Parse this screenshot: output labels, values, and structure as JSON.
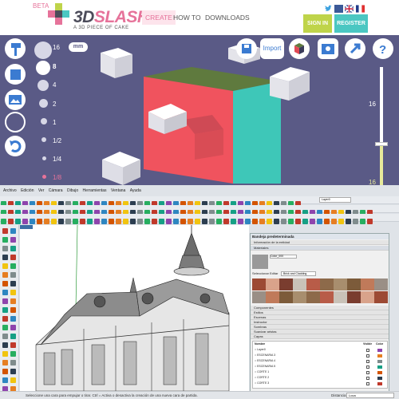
{
  "topbar": {
    "beta": "BETA",
    "logo_main": "3D",
    "logo_accent": "SLASH",
    "logo_tagline": "A 3D PIECE OF CAKE",
    "nav": {
      "create": "CREATE",
      "howto": "HOW TO",
      "downloads": "DOWNLOADS"
    },
    "signin": "SIGN IN",
    "register": "REGISTER",
    "social_icons": [
      "twitter-icon",
      "facebook-icon",
      "uk-flag-icon",
      "france-flag-icon"
    ]
  },
  "viewport": {
    "sizes": [
      "16",
      "8",
      "4",
      "2",
      "1",
      "1/2",
      "1/4",
      "1/8"
    ],
    "unit": "mm",
    "import_label": "Import",
    "slider_top": "16",
    "slider_bottom": "16",
    "slider_level_fraction": 0.35,
    "left_tools": [
      "hammer-icon",
      "cube-icon",
      "image-icon",
      "circle-icon",
      "undo-icon"
    ],
    "top_tools": [
      "save-icon",
      "import-button",
      "color-cube-icon",
      "photo-icon",
      "share-icon",
      "help-icon"
    ],
    "colors": {
      "background": "#5a5a86",
      "accent_pink": "#e6739a",
      "accent_green": "#bfd44a",
      "accent_teal": "#4bc7c2"
    }
  },
  "sketchup": {
    "menu": [
      "Archivo",
      "Edición",
      "Ver",
      "Cámara",
      "Dibujo",
      "Herramientas",
      "Ventana",
      "Ayuda"
    ],
    "layer_dropdown": "Layer0",
    "tray": {
      "title": "Bandeja predeterminada",
      "sections_top": [
        "Información de la entidad",
        "Materiales"
      ],
      "material_name": "Color_000",
      "tab_select": "Seleccionar",
      "tab_edit": "Editar",
      "material_category": "Brick and Cladding",
      "sections_bottom": [
        "Componentes",
        "Estilos",
        "Escenas",
        "Instructor",
        "Sombras",
        "Suavizar aristas",
        "Capas"
      ],
      "layers_header_name": "Nombre",
      "layers_header_visible": "Visible",
      "layers_header_color": "Color",
      "layers": [
        "Layer0",
        "ESCENARIA 3",
        "ESCENARIA 4",
        "ESCENARIA 5",
        "CORTE 1",
        "CORTE 2",
        "CORTE 3"
      ]
    },
    "status": "Seleccione una cara para empujar o tirar. Ctrl = Activa o desactiva la creación de una nueva cara de partida.",
    "measure_label": "Distancia",
    "measure_value": "Loca"
  }
}
